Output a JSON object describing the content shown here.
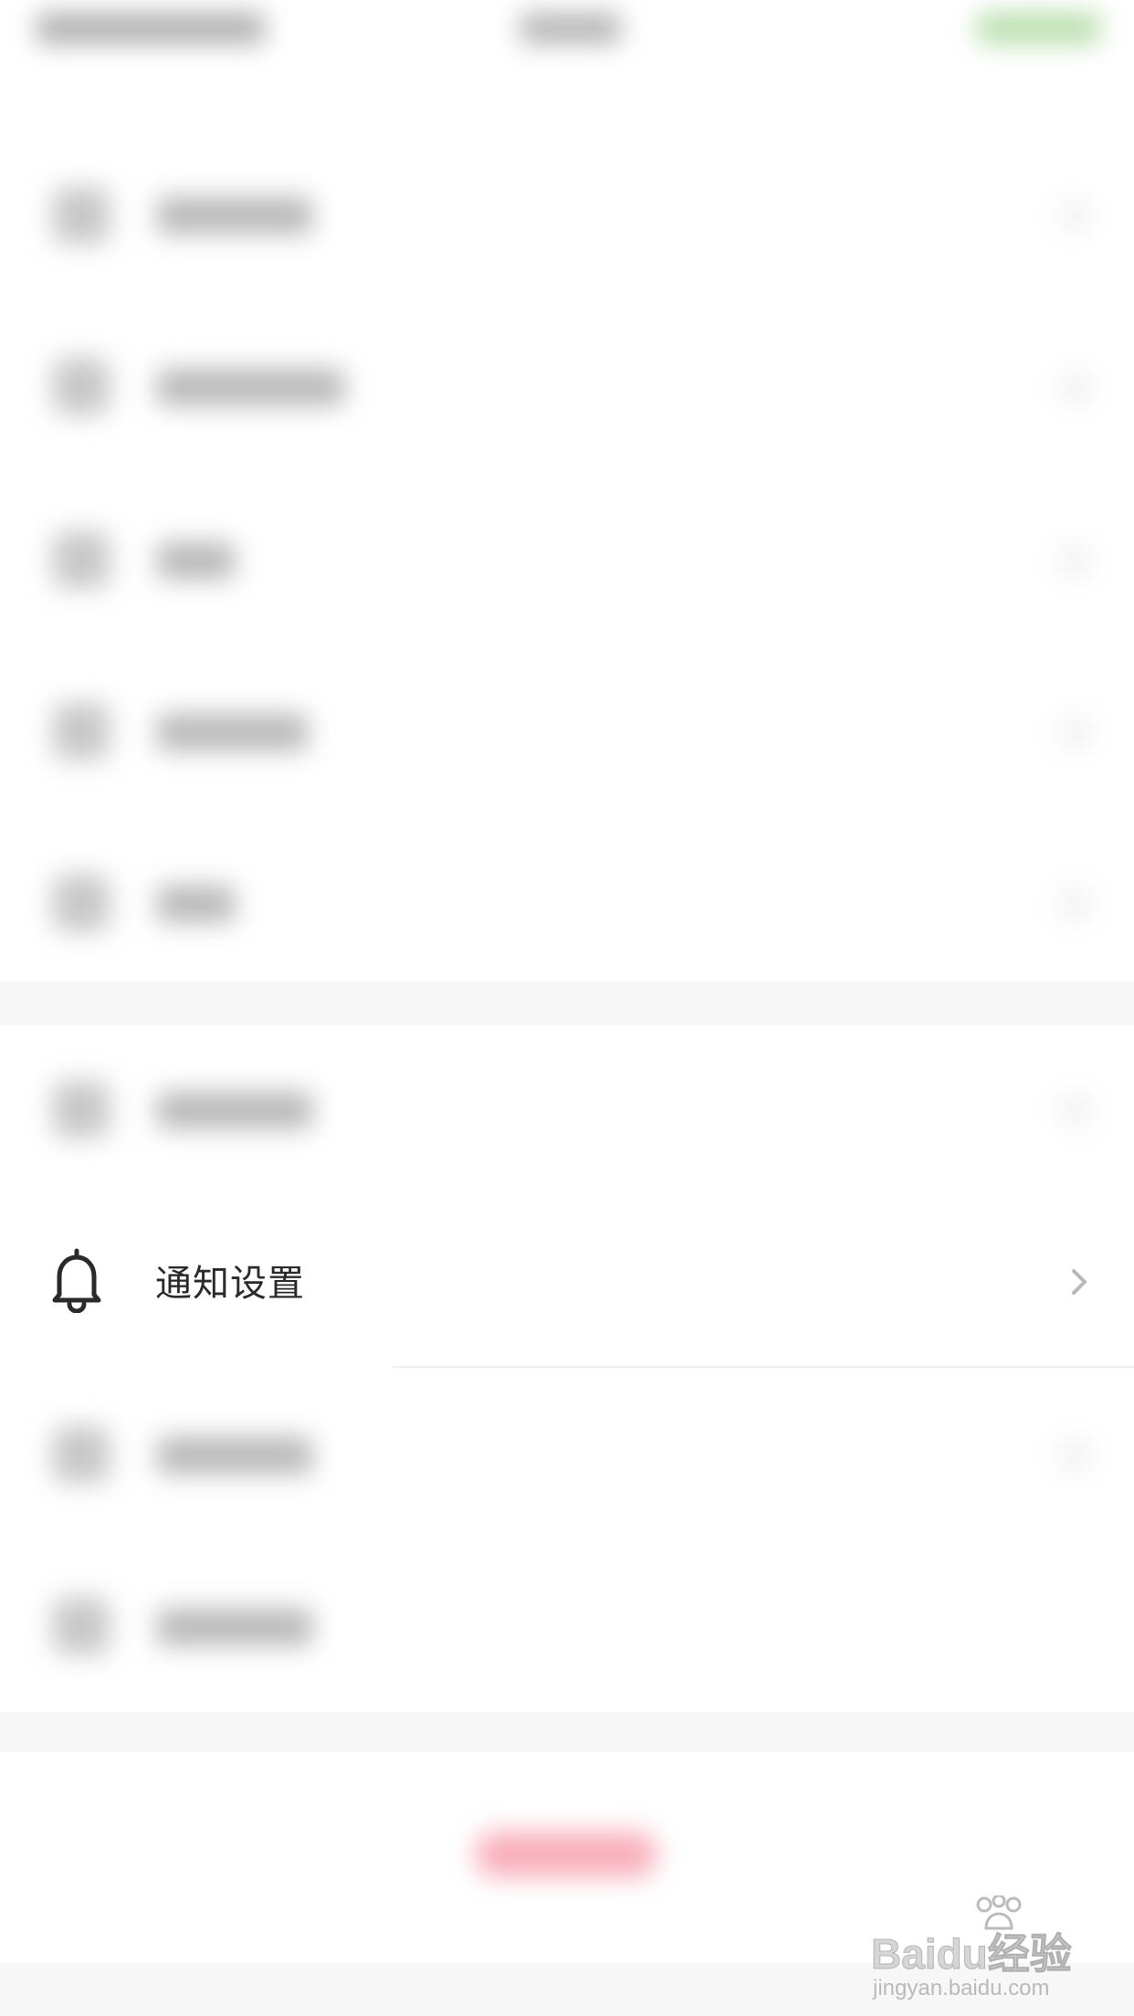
{
  "focused_row": {
    "label": "通知设置",
    "icon": "bell-icon",
    "chevron": "chevron-right-icon"
  },
  "watermark": {
    "brand": "Baidu经验",
    "url": "jingyan.baidu.com"
  },
  "colors": {
    "background": "#ffffff",
    "section_gap": "#f1f1f3",
    "label_text": "#2a2a2a",
    "blurred_button": "#f26c84",
    "blurred_header_accent": "#7fc36b"
  }
}
